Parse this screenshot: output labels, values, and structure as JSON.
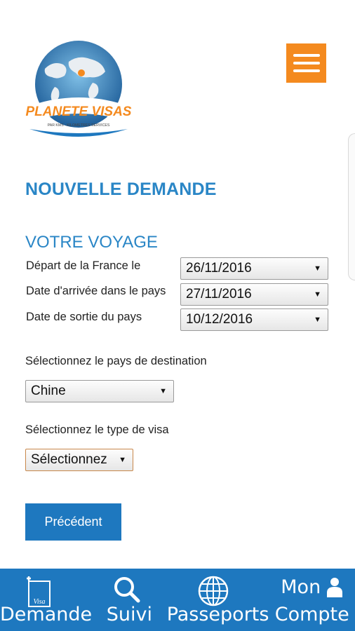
{
  "logo": {
    "brand": "PLANETE VISAS",
    "tagline": "PAR KMS - KILOMETRES SERVICES"
  },
  "page": {
    "title": "NOUVELLE DEMANDE",
    "section": "VOTRE VOYAGE"
  },
  "dates": [
    {
      "label": "Départ de la France le",
      "value": "26/11/2016"
    },
    {
      "label": "Date d'arrivée dans le pays",
      "value": "27/11/2016"
    },
    {
      "label": "Date de sortie du pays",
      "value": "10/12/2016"
    }
  ],
  "destination": {
    "label": "Sélectionnez le pays de destination",
    "value": "Chine"
  },
  "visa_type": {
    "label": "Sélectionnez le type de visa",
    "value": "Sélectionnez"
  },
  "buttons": {
    "previous": "Précédent"
  },
  "nav": {
    "demande": "Demande",
    "suivi": "Suivi",
    "passeports": "Passeports",
    "compte_top": "Mon",
    "compte": "Compte",
    "visa_badge": "Visa"
  },
  "colors": {
    "brand_blue": "#1e78bf",
    "title_blue": "#2a86c6",
    "accent_orange": "#f48a1f"
  }
}
